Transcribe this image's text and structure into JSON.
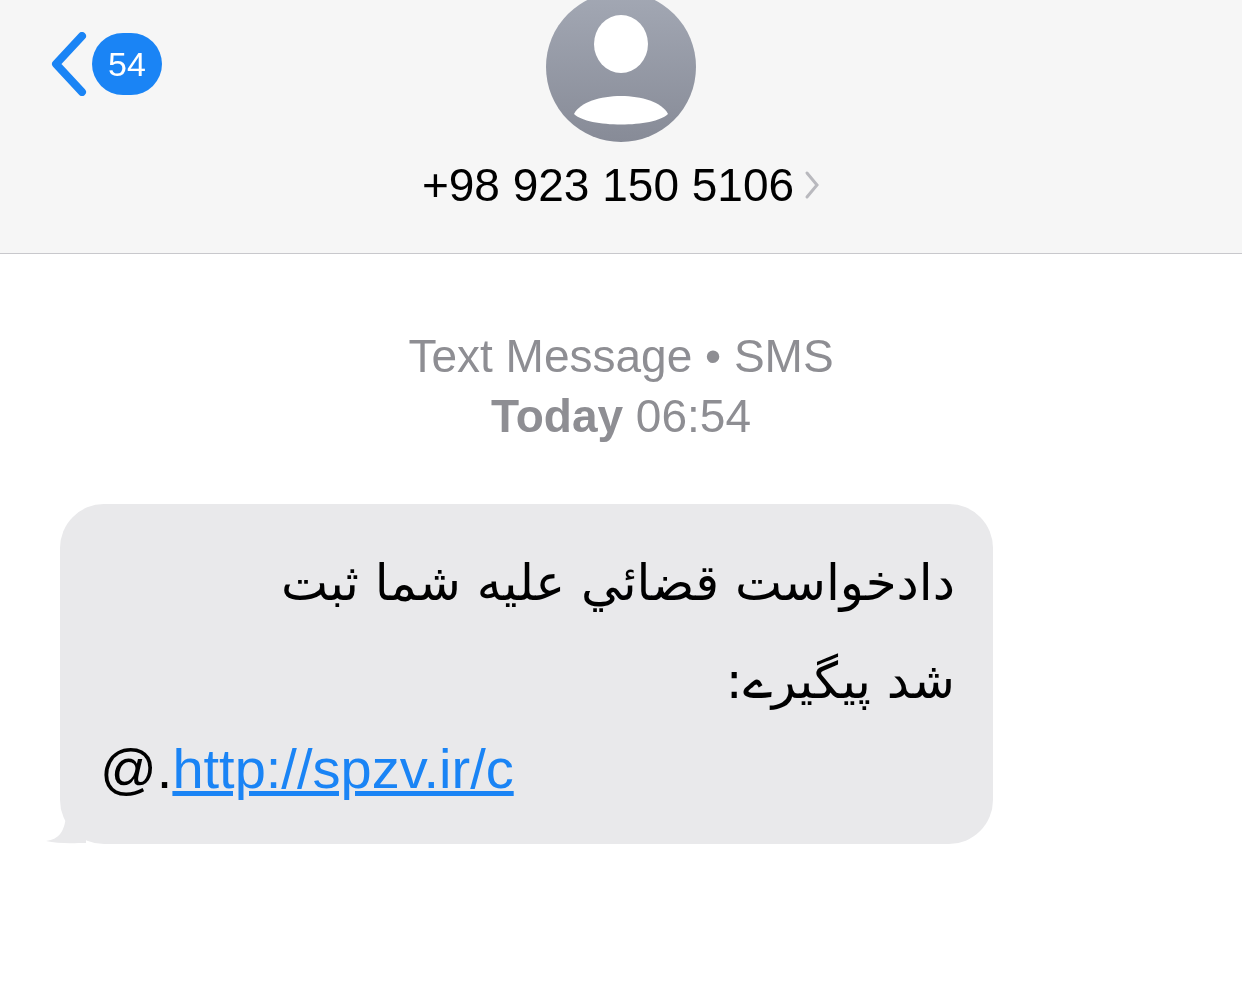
{
  "nav": {
    "back_count": "54",
    "contact": "+98 923 150 5106"
  },
  "thread": {
    "service": "Text Message • SMS",
    "time_label": "Today",
    "time": "06:54"
  },
  "messages": [
    {
      "kind": "incoming",
      "text": "دادخواست قضائي عليه شما ثبت شد پيگيرے:",
      "link": "http://spzv.ir/c",
      "trail": "@."
    }
  ]
}
